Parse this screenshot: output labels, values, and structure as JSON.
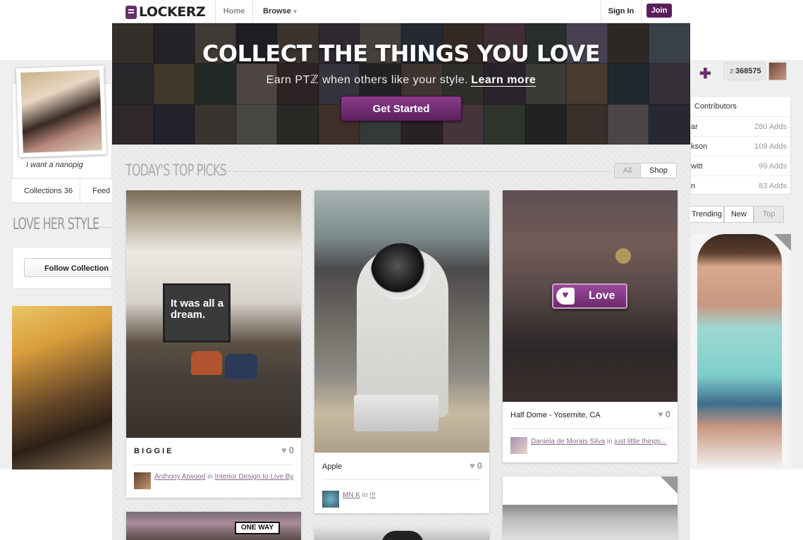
{
  "topbar": {
    "logo": "LOCKERZ",
    "home": "Home",
    "browse": "Browse",
    "signin": "Sign In",
    "join": "Join"
  },
  "hero": {
    "title": "COLLECT THE THINGS YOU LOVE",
    "subtitle": "Earn PTℤ when others like your style.",
    "learn_more": "Learn more",
    "cta": "Get Started"
  },
  "picks": {
    "title": "TODAY'S TOP PICKS",
    "filter_all": "All",
    "filter_shop": "Shop"
  },
  "cards": [
    {
      "caption": "BIGGIE",
      "likes": "0",
      "poster_text": "It was all a dream.",
      "user": "Anthony Atwood",
      "in": "in",
      "collection": "Interior Design to Live By"
    },
    {
      "caption": "Apple",
      "likes": "0",
      "user": "MN K",
      "in": "in",
      "collection": "!!!"
    },
    {
      "caption": "Half Dome - Yosemite, CA",
      "likes": "0",
      "love_label": "Love",
      "user": "Daniela de Morais Silva",
      "in": "in",
      "collection": "just little things..."
    }
  ],
  "bottom_sign": "ONE WAY",
  "background": {
    "quote": "I want a nanopig",
    "tab_collections": "Collections 36",
    "tab_feed": "Feed",
    "love_her_style": "LOVE HER STYLE",
    "follow_collection": "Follow Collection",
    "points": "368575",
    "contributors_title": "Contributors",
    "contributors": [
      {
        "name": "ar",
        "adds": "280 Adds"
      },
      {
        "name": "kson",
        "adds": "109 Adds"
      },
      {
        "name": "witt",
        "adds": "99 Adds"
      },
      {
        "name": "n",
        "adds": "83 Adds"
      }
    ],
    "sort_trending": "Trending",
    "sort_new": "New",
    "sort_top": "Top"
  },
  "colors": {
    "brand_purple": "#6b2d6b",
    "cta_purple": "#7a327a"
  },
  "icons": {
    "logo": "lockerz-logo-icon",
    "heart": "heart-icon",
    "plus": "plus-icon",
    "caret": "chevron-down-icon"
  }
}
